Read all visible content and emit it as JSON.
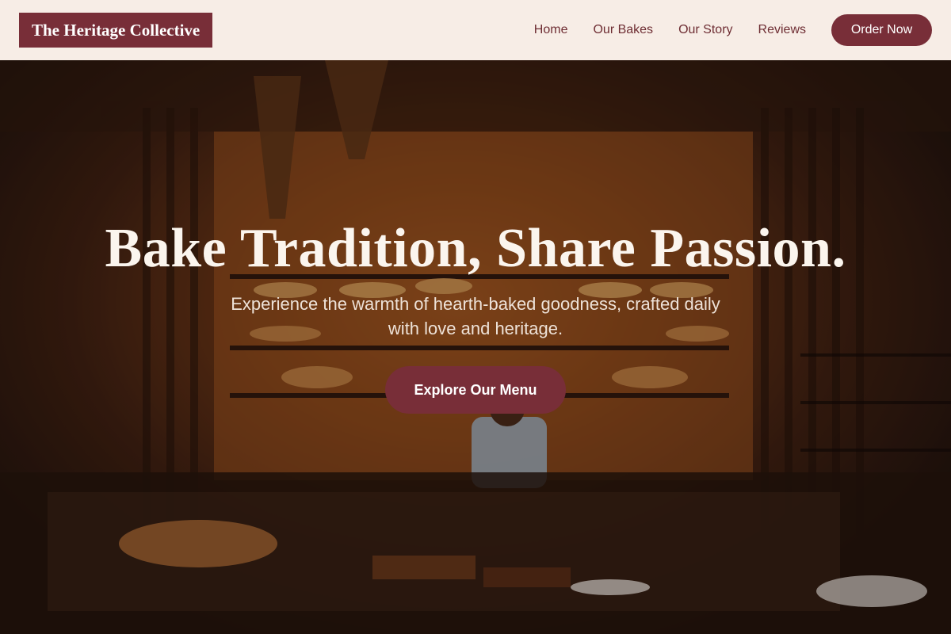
{
  "brand": {
    "name": "The Heritage Collective"
  },
  "nav": {
    "items": [
      {
        "label": "Home"
      },
      {
        "label": "Our Bakes"
      },
      {
        "label": "Our Story"
      },
      {
        "label": "Reviews"
      }
    ],
    "cta_label": "Order Now"
  },
  "hero": {
    "title": "Bake Tradition, Share Passion.",
    "subtitle": "Experience the warmth of hearth-baked goodness, crafted daily with love and heritage.",
    "cta_label": "Explore Our Menu",
    "background": "bakery-interior-photo"
  },
  "colors": {
    "accent": "#782e38",
    "header_bg": "#f7ede6",
    "nav_text": "#6e2d33"
  }
}
